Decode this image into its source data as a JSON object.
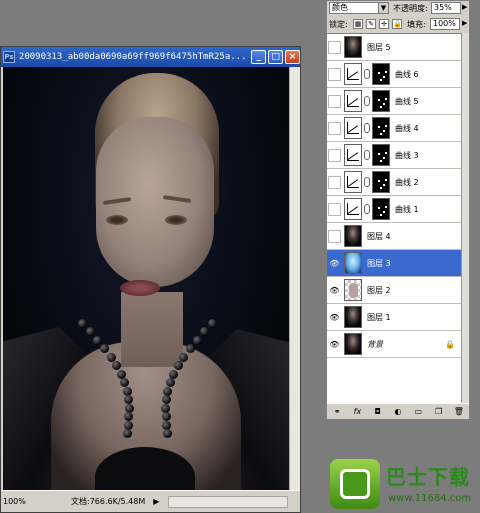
{
  "document": {
    "title": "20090313_ab00da0690a69ff969f6475hTmR25a...",
    "zoom": "100%",
    "doc_info": "文档:766.6K/5.48M",
    "status_arrow": "▶"
  },
  "layers_panel": {
    "blend_mode": "颜色",
    "opacity_label": "不透明度:",
    "opacity_value": "35%",
    "lock_label": "锁定:",
    "fill_label": "填充:",
    "fill_value": "100%",
    "layers": [
      {
        "name": "图层 5",
        "visible": false,
        "thumb": "dark"
      },
      {
        "name": "曲线 6",
        "visible": false,
        "thumb": "curve"
      },
      {
        "name": "曲线 5",
        "visible": false,
        "thumb": "curve"
      },
      {
        "name": "曲线 4",
        "visible": false,
        "thumb": "curve"
      },
      {
        "name": "曲线 3",
        "visible": false,
        "thumb": "curve"
      },
      {
        "name": "曲线 2",
        "visible": false,
        "thumb": "curve"
      },
      {
        "name": "曲线 1",
        "visible": false,
        "thumb": "curve"
      },
      {
        "name": "图层 4",
        "visible": false,
        "thumb": "dark"
      },
      {
        "name": "图层 3",
        "visible": true,
        "thumb": "cyan",
        "selected": true
      },
      {
        "name": "图层 2",
        "visible": true,
        "thumb": "transparent"
      },
      {
        "name": "图层 1",
        "visible": true,
        "thumb": "dark"
      },
      {
        "name": "背景",
        "visible": true,
        "thumb": "dark",
        "locked": true
      }
    ],
    "footer_icons": [
      "link-icon",
      "fx-icon",
      "mask-icon",
      "adjustment-icon",
      "group-icon",
      "new-layer-icon",
      "trash-icon"
    ]
  },
  "watermark": {
    "name": "巴士下载",
    "url": "www.11684.com"
  },
  "colors": {
    "titlebar": "#2f68c9",
    "selected_layer": "#3a6ad0",
    "workspace": "#7c7c7c",
    "watermark_green": "#2a8a1a"
  }
}
